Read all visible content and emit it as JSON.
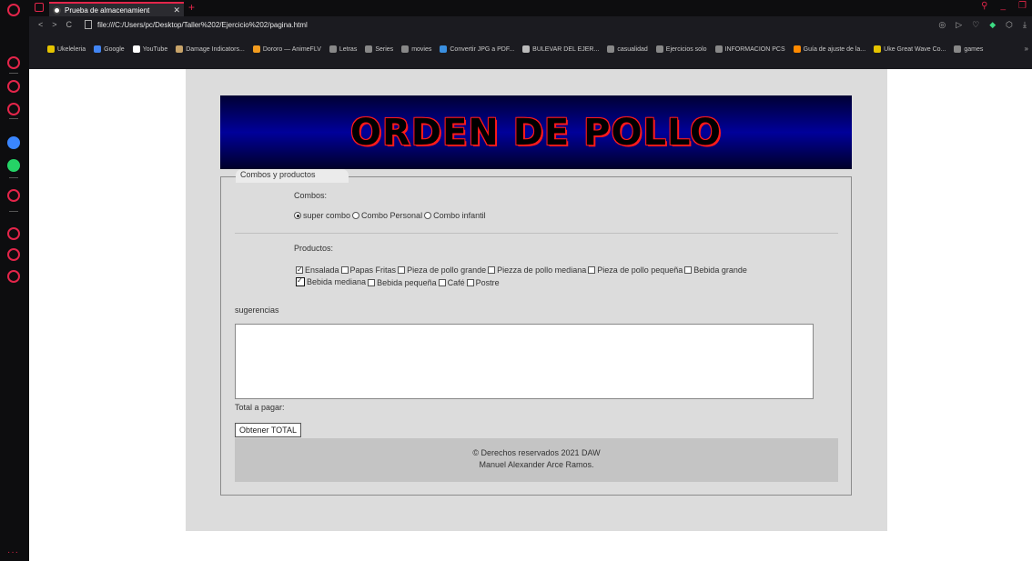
{
  "browser": {
    "tab_title": "Prueba de almacenamient",
    "tab_close": "✕",
    "new_tab": "+",
    "url": "file:///C:/Users/pc/Desktop/Taller%202/Ejercicio%202/pagina.html",
    "bookmarks": [
      {
        "label": "Ukeleleria",
        "color": "#e5c400"
      },
      {
        "label": "Google",
        "color": "#4285f4"
      },
      {
        "label": "YouTube",
        "color": "#ffffff"
      },
      {
        "label": "Damage Indicators...",
        "color": "#c9a46a"
      },
      {
        "label": "Dororo — AnimeFLV",
        "color": "#f29c1f"
      },
      {
        "label": "Letras",
        "color": "#888888"
      },
      {
        "label": "Series",
        "color": "#888888"
      },
      {
        "label": "movies",
        "color": "#888888"
      },
      {
        "label": "Convertir JPG a PDF...",
        "color": "#3a8fe0"
      },
      {
        "label": "BULEVAR DEL EJER...",
        "color": "#bbbbbb"
      },
      {
        "label": "casualidad",
        "color": "#888888"
      },
      {
        "label": "Ejercicios solo",
        "color": "#888888"
      },
      {
        "label": "INFORMACION PCS",
        "color": "#888888"
      },
      {
        "label": "Guía de ajuste de la...",
        "color": "#ff8a00"
      },
      {
        "label": "Uke Great Wave Co...",
        "color": "#e5c400"
      },
      {
        "label": "games",
        "color": "#888888"
      }
    ],
    "bookmarks_more": "»"
  },
  "page": {
    "banner_title": "ORDEN DE POLLO",
    "legend": "Combos y productos",
    "combos_label": "Combos:",
    "combos": [
      {
        "label": "super combo",
        "checked": true
      },
      {
        "label": "Combo Personal",
        "checked": false
      },
      {
        "label": "Combo infantil",
        "checked": false
      }
    ],
    "products_label": "Productos:",
    "products": [
      {
        "label": "Ensalada",
        "checked": true
      },
      {
        "label": "Papas Fritas",
        "checked": false
      },
      {
        "label": "Pieza de pollo grande",
        "checked": false
      },
      {
        "label": "Piezza de pollo mediana",
        "checked": false
      },
      {
        "label": "Pieza de pollo pequeña",
        "checked": false
      },
      {
        "label": "Bebida grande",
        "checked": false
      },
      {
        "label": "Bebida mediana",
        "checked": true
      },
      {
        "label": "Bebida pequeña",
        "checked": false
      },
      {
        "label": "Café",
        "checked": false
      },
      {
        "label": "Postre",
        "checked": false
      }
    ],
    "suggestions_label": "sugerencias",
    "suggestions_value": "",
    "total_label": "Total a pagar:",
    "total_button": "Obtener TOTAL",
    "footer_line1": "© Derechos reservados 2021 DAW",
    "footer_line2": "Manuel Alexander Arce Ramos."
  },
  "colors": {
    "accent": "#e3254a",
    "banner_blue": "#00009a",
    "title_outline": "#ff1a1a"
  }
}
